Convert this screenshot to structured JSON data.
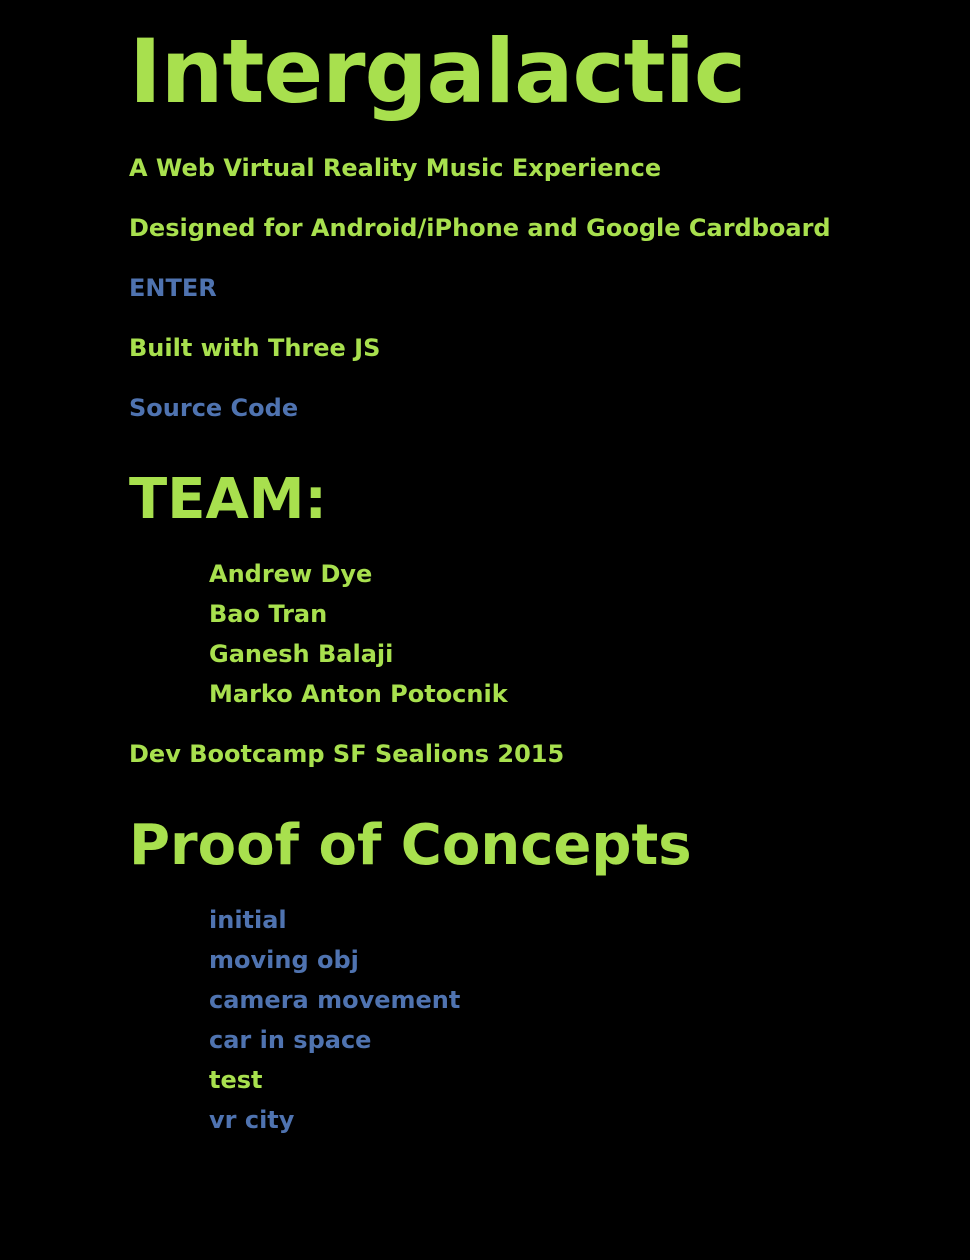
{
  "title": "Intergalactic",
  "subtitle": "A Web Virtual Reality Music Experience",
  "designed_for": "Designed for Android/iPhone and Google Cardboard",
  "enter_link": "ENTER",
  "built_with": "Built with Three JS",
  "source_link": "Source Code",
  "team": {
    "heading": "TEAM:",
    "members": [
      "Andrew Dye",
      "Bao Tran",
      "Ganesh Balaji",
      "Marko Anton Potocnik"
    ]
  },
  "cohort": "Dev Bootcamp SF Sealions 2015",
  "poc": {
    "heading": "Proof of Concepts",
    "items": [
      {
        "label": "initial",
        "is_link": true
      },
      {
        "label": "moving obj",
        "is_link": true
      },
      {
        "label": "camera movement",
        "is_link": true
      },
      {
        "label": "car in space",
        "is_link": true
      },
      {
        "label": "test",
        "is_link": false
      },
      {
        "label": "vr city",
        "is_link": true
      }
    ]
  },
  "colors": {
    "background": "#000000",
    "text": "#a8e04e",
    "link": "#4f73b0"
  }
}
